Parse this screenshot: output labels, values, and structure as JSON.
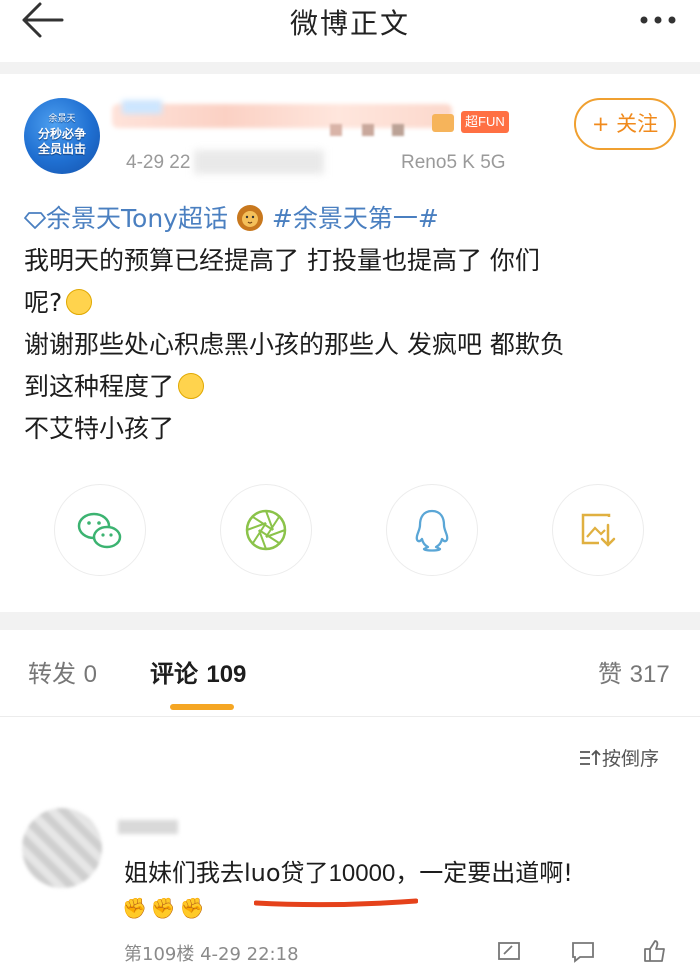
{
  "header": {
    "title": "微博正文",
    "back_icon": "back-arrow-icon",
    "more_icon": "more-dots-icon"
  },
  "post": {
    "avatar_text": [
      "余景天",
      "分秒必争",
      "全员出击"
    ],
    "badge_fun": "超FUN",
    "meta": "4-29 22",
    "device": "Reno5 K 5G",
    "follow_label": "+ 关注",
    "topic": "余景天Tony超话",
    "hashtag": "#余景天第一#",
    "lines": [
      "我明天的预算已经提高了 打投量也提高了 你们",
      "呢?",
      "谢谢那些处心积虑黑小孩的那些人 发疯吧 都欺负",
      "到这种程度了",
      "不艾特小孩了"
    ]
  },
  "share": [
    {
      "name": "wechat-share-button",
      "icon": "wechat-icon"
    },
    {
      "name": "moments-share-button",
      "icon": "moments-icon"
    },
    {
      "name": "qq-share-button",
      "icon": "qq-icon"
    },
    {
      "name": "save-image-button",
      "icon": "save-image-icon"
    }
  ],
  "tabs": {
    "repost_label": "转发",
    "repost_count": "0",
    "comment_label": "评论",
    "comment_count": "109",
    "like_label": "赞",
    "like_count": "317"
  },
  "sort_label": "按倒序",
  "comment": {
    "text_a": "姐妹们我去luo贷了",
    "amount": "10000",
    "text_b": "，一定要出道啊!",
    "floor_meta": "第109楼 4-29 22:18"
  },
  "colors": {
    "accent": "#f5a623",
    "follow": "#f08a1c",
    "link": "#4a7fc0",
    "underline_red": "#e5421b"
  }
}
